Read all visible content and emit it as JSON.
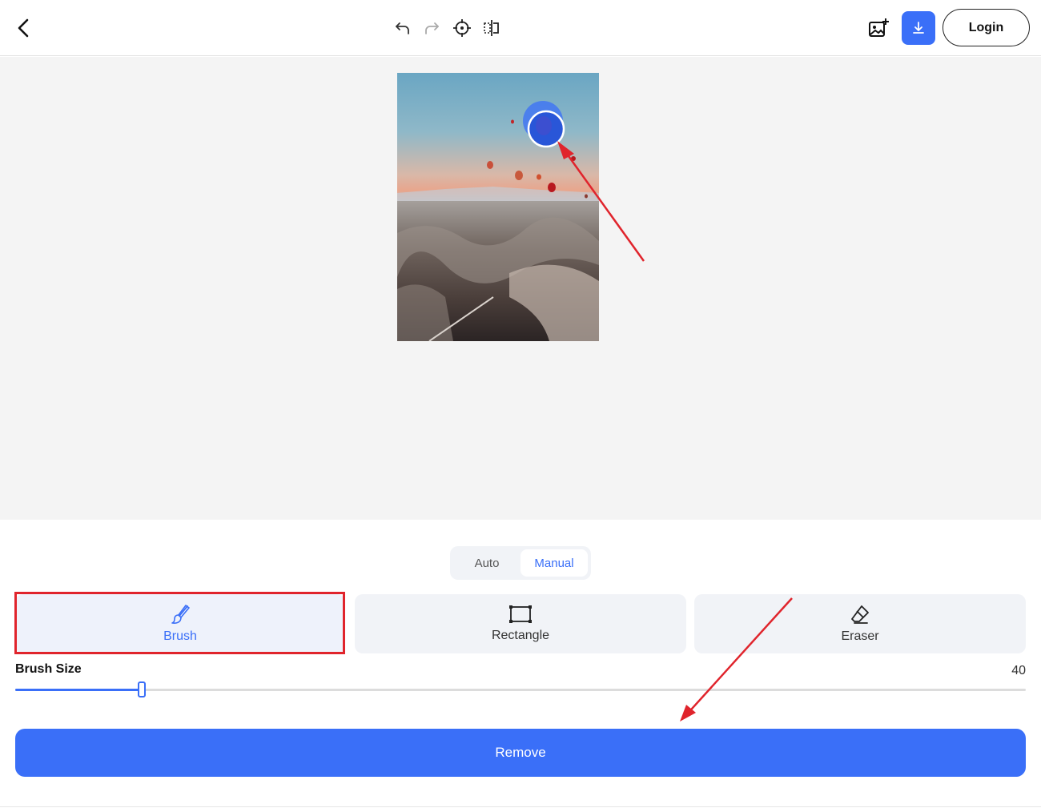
{
  "toolbar": {
    "back_icon": "chevron-left-icon",
    "undo_icon": "undo-icon",
    "redo_icon": "redo-icon",
    "crosshair_icon": "crosshair-icon",
    "compare_icon": "compare-split-icon",
    "add_image_icon": "add-image-icon",
    "download_icon": "download-icon",
    "login_label": "Login"
  },
  "mode": {
    "options": [
      "Auto",
      "Manual"
    ],
    "selected": "Manual"
  },
  "tools": [
    {
      "label": "Brush",
      "icon": "brush-icon",
      "active": true
    },
    {
      "label": "Rectangle",
      "icon": "rectangle-icon",
      "active": false
    },
    {
      "label": "Eraser",
      "icon": "eraser-icon",
      "active": false
    }
  ],
  "brush_size": {
    "label": "Brush Size",
    "value": "40",
    "fraction": 0.125
  },
  "remove_label": "Remove",
  "colors": {
    "accent": "#3a6ff8",
    "annotation": "#e0242c"
  }
}
